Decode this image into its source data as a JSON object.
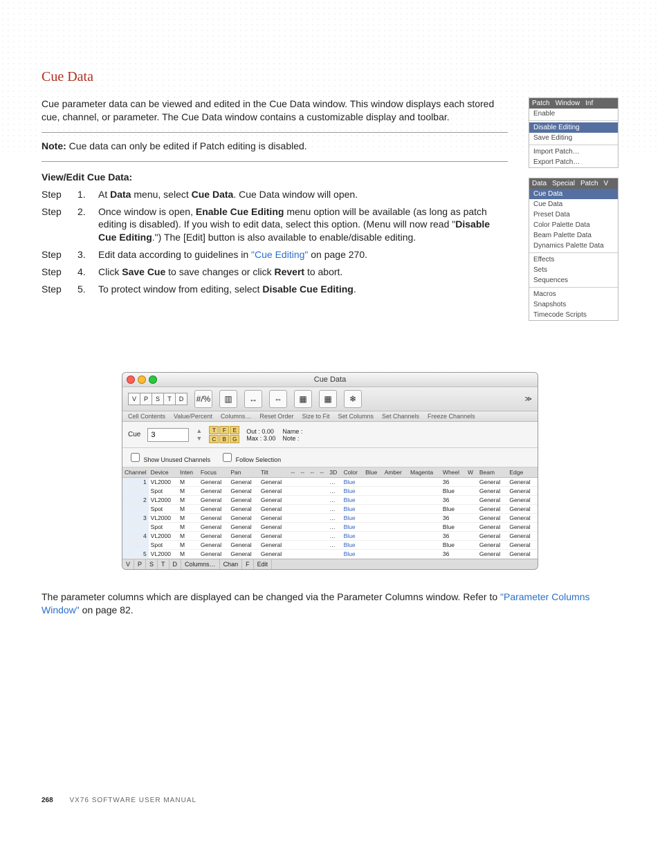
{
  "section_title": "Cue Data",
  "intro": "Cue parameter data can be viewed and edited in the Cue Data window. This window displays each stored cue, channel, or parameter. The Cue Data window contains a customizable display and toolbar.",
  "note_label": "Note:",
  "note_text": "Cue data can only be edited if Patch editing is disabled.",
  "subhead": "View/Edit Cue Data:",
  "steps": [
    {
      "n": "1.",
      "pre": "At ",
      "b1": "Data",
      "mid1": " menu, select ",
      "b2": "Cue Data",
      "post": ". Cue Data window will open."
    },
    {
      "n": "2.",
      "pre": "Once window is open, ",
      "b1": "Enable Cue Editing",
      "mid1": " menu option will be available (as long as patch editing is disabled). If you wish to edit data, select this option. (Menu will now read \"",
      "b2": "Disable Cue Editing",
      "post": ".\") The [Edit] button is also available to enable/disable editing."
    },
    {
      "n": "3.",
      "pre": "Edit data according to guidelines in ",
      "link": "\"Cue Editing\"",
      "post": " on page 270."
    },
    {
      "n": "4.",
      "pre": "Click ",
      "b1": "Save Cue",
      "mid1": " to save changes or click ",
      "b2": "Revert",
      "post": " to abort."
    },
    {
      "n": "5.",
      "pre": "To protect window from editing, select ",
      "b1": "Disable Cue Editing",
      "post": "."
    }
  ],
  "side_menus": {
    "patch": {
      "tabs": [
        "Patch",
        "Window",
        "Inf"
      ],
      "items": [
        "Enable",
        "Disable Editing",
        "Save Editing",
        "Import Patch…",
        "Export Patch…"
      ],
      "highlight_index": 1
    },
    "data": {
      "tabs": [
        "Data",
        "Special",
        "Patch",
        "V"
      ],
      "groups": [
        [
          "Cue Data",
          "Cue Data",
          "Preset Data",
          "Color Palette Data",
          "Beam Palette Data",
          "Dynamics Palette Data"
        ],
        [
          "Effects",
          "Sets",
          "Sequences"
        ],
        [
          "Macros",
          "Snapshots",
          "Timecode Scripts"
        ]
      ],
      "highlight_index": 0
    }
  },
  "window": {
    "title": "Cue Data",
    "tbtn_letters": [
      "V",
      "P",
      "S",
      "T",
      "D"
    ],
    "toolbar_labels": [
      "Cell Contents",
      "Value/Percent",
      "Columns…",
      "Reset Order",
      "Size to Fit",
      "Set Columns",
      "Set Channels",
      "Freeze Channels"
    ],
    "cue_label": "Cue",
    "cue_value": "3",
    "tfe": [
      "T",
      "F",
      "E",
      "C",
      "B",
      "G"
    ],
    "out_label": "Out :",
    "out_value": "0.00",
    "max_label": "Max :",
    "max_value": "3.00",
    "name_label": "Name :",
    "note_label": "Note :",
    "check1": "Show Unused Channels",
    "check2": "Follow Selection",
    "columns": [
      "Channel",
      "Device",
      "Inten",
      "Focus",
      "Pan",
      "Tilt",
      "--",
      "--",
      "--",
      "--",
      "3D",
      "Color",
      "Blue",
      "Amber",
      "Magenta",
      "Wheel",
      "W",
      "Beam",
      "Edge"
    ],
    "rows": [
      {
        "ch": "1",
        "dev": "VL2000",
        "inten": "M",
        "focus": "General",
        "pan": "General",
        "tilt": "General",
        "dots": "…",
        "color": "Blue",
        "wheel": "36",
        "beam": "General",
        "edge": "General"
      },
      {
        "ch": "",
        "dev": "Spot",
        "inten": "M",
        "focus": "General",
        "pan": "General",
        "tilt": "General",
        "dots": "…",
        "color": "Blue",
        "wheel": "Blue",
        "beam": "General",
        "edge": "General"
      },
      {
        "ch": "2",
        "dev": "VL2000",
        "inten": "M",
        "focus": "General",
        "pan": "General",
        "tilt": "General",
        "dots": "…",
        "color": "Blue",
        "wheel": "36",
        "beam": "General",
        "edge": "General"
      },
      {
        "ch": "",
        "dev": "Spot",
        "inten": "M",
        "focus": "General",
        "pan": "General",
        "tilt": "General",
        "dots": "…",
        "color": "Blue",
        "wheel": "Blue",
        "beam": "General",
        "edge": "General"
      },
      {
        "ch": "3",
        "dev": "VL2000",
        "inten": "M",
        "focus": "General",
        "pan": "General",
        "tilt": "General",
        "dots": "…",
        "color": "Blue",
        "wheel": "36",
        "beam": "General",
        "edge": "General"
      },
      {
        "ch": "",
        "dev": "Spot",
        "inten": "M",
        "focus": "General",
        "pan": "General",
        "tilt": "General",
        "dots": "…",
        "color": "Blue",
        "wheel": "Blue",
        "beam": "General",
        "edge": "General"
      },
      {
        "ch": "4",
        "dev": "VL2000",
        "inten": "M",
        "focus": "General",
        "pan": "General",
        "tilt": "General",
        "dots": "…",
        "color": "Blue",
        "wheel": "36",
        "beam": "General",
        "edge": "General"
      },
      {
        "ch": "",
        "dev": "Spot",
        "inten": "M",
        "focus": "General",
        "pan": "General",
        "tilt": "General",
        "dots": "…",
        "color": "Blue",
        "wheel": "Blue",
        "beam": "General",
        "edge": "General"
      },
      {
        "ch": "5",
        "dev": "VL2000",
        "inten": "M",
        "focus": "General",
        "pan": "General",
        "tilt": "General",
        "dots": "",
        "color": "Blue",
        "wheel": "36",
        "beam": "General",
        "edge": "General"
      }
    ],
    "status": [
      "V",
      "P",
      "S",
      "T",
      "D",
      "Columns…",
      "Chan",
      "F",
      "Edit"
    ]
  },
  "closing_pre": "The parameter columns which are displayed can be changed via the Parameter Columns window. Refer to ",
  "closing_link": "\"Parameter Columns Window\"",
  "closing_post": " on page 82.",
  "footer_page": "268",
  "footer_text": "VX76 SOFTWARE USER MANUAL"
}
